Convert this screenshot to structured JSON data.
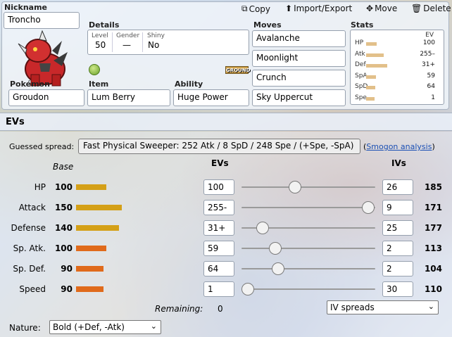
{
  "toolbar": {
    "copy": "Copy",
    "import_export": "Import/Export",
    "move": "Move",
    "delete": "Delete"
  },
  "nickname": {
    "label": "Nickname",
    "value": "Troncho"
  },
  "details": {
    "label": "Details",
    "level_label": "Level",
    "level": "50",
    "gender_label": "Gender",
    "gender": "—",
    "shiny_label": "Shiny",
    "shiny": "No"
  },
  "type_badge": "GROUND",
  "pokemon": {
    "label": "Pokémon",
    "value": "Groudon"
  },
  "item": {
    "label": "Item",
    "value": "Lum Berry"
  },
  "ability": {
    "label": "Ability",
    "value": "Huge Power"
  },
  "moves": {
    "label": "Moves",
    "list": [
      "Avalanche",
      "Moonlight",
      "Crunch",
      "Sky Uppercut"
    ]
  },
  "stats_summary": {
    "label": "Stats",
    "ev_header": "EV",
    "rows": [
      {
        "name": "HP",
        "ev": "100",
        "bar": 0.15
      },
      {
        "name": "Atk",
        "ev": "255–",
        "bar": 0.25
      },
      {
        "name": "Def",
        "ev": "31+",
        "bar": 0.3
      },
      {
        "name": "SpA",
        "ev": "59",
        "bar": 0.14
      },
      {
        "name": "SpD",
        "ev": "64",
        "bar": 0.13
      },
      {
        "name": "Spe",
        "ev": "1",
        "bar": 0.12
      }
    ]
  },
  "ev_panel": {
    "title": "EVs",
    "guessed_label": "Guessed spread:",
    "guessed_value": "Fast Physical Sweeper: 252 Atk / 8 SpD / 248 Spe / (+Spe, -SpA)",
    "smogon_open": "(",
    "smogon_link": "Smogon analysis",
    "smogon_close": ")",
    "base_header": "Base",
    "evs_header": "EVs",
    "ivs_header": "IVs",
    "remaining_label": "Remaining:",
    "remaining": "0",
    "iv_spreads": "IV spreads",
    "nature_label": "Nature:",
    "nature": "Bold (+Def, -Atk)"
  },
  "stat_rows": [
    {
      "name": "HP",
      "base": "100",
      "base_frac": 0.39,
      "bar_color": "#d4a017",
      "ev": "100",
      "slider": 0.39,
      "iv": "26",
      "total": "185"
    },
    {
      "name": "Attack",
      "base": "150",
      "base_frac": 0.59,
      "bar_color": "#d4a017",
      "ev": "255-",
      "slider": 1.0,
      "iv": "9",
      "total": "171"
    },
    {
      "name": "Defense",
      "base": "140",
      "base_frac": 0.55,
      "bar_color": "#d4a017",
      "ev": "31+",
      "slider": 0.12,
      "iv": "25",
      "total": "177"
    },
    {
      "name": "Sp. Atk.",
      "base": "100",
      "base_frac": 0.39,
      "bar_color": "#e06a1b",
      "ev": "59",
      "slider": 0.23,
      "iv": "2",
      "total": "113"
    },
    {
      "name": "Sp. Def.",
      "base": "90",
      "base_frac": 0.35,
      "bar_color": "#e06a1b",
      "ev": "64",
      "slider": 0.25,
      "iv": "2",
      "total": "104"
    },
    {
      "name": "Speed",
      "base": "90",
      "base_frac": 0.35,
      "bar_color": "#e06a1b",
      "ev": "1",
      "slider": 0.0,
      "iv": "30",
      "total": "110"
    }
  ]
}
